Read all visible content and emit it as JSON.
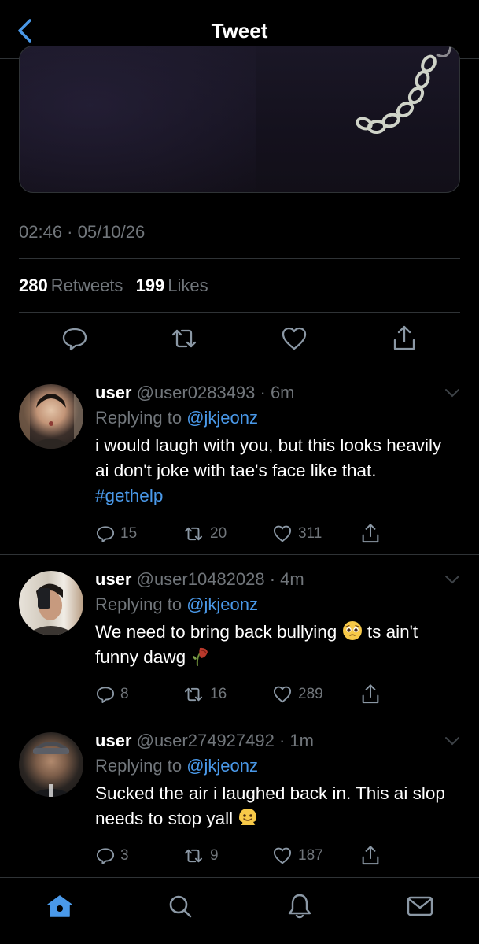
{
  "header": {
    "title": "Tweet"
  },
  "tweet": {
    "timestamp": "02:46 · 05/10/26",
    "retweets": "280",
    "retweets_label": "Retweets",
    "likes": "199",
    "likes_label": "Likes"
  },
  "replies": [
    {
      "name": "user",
      "meta": "@user0283493 · 6m",
      "replying_prefix": "Replying to",
      "replying_handle": "@jkjeonz",
      "text": "i would laugh with you, but this looks heavily ai don't joke with tae's face like that.",
      "hashtag": "#gethelp",
      "replies": "15",
      "retweets": "20",
      "likes": "311"
    },
    {
      "name": "user",
      "meta": "@user10482028 · 4m",
      "replying_prefix": "Replying to",
      "replying_handle": "@jkjeonz",
      "text_a": "We need to bring back bullying",
      "text_b": "ts ain't funny dawg",
      "replies": "8",
      "retweets": "16",
      "likes": "289"
    },
    {
      "name": "user",
      "meta": "@user274927492 · 1m",
      "replying_prefix": "Replying to",
      "replying_handle": "@jkjeonz",
      "text": "Sucked the air i laughed back in. This ai slop needs to stop yall",
      "replies": "3",
      "retweets": "9",
      "likes": "187"
    }
  ],
  "icons": {
    "back": "chevron-left-icon",
    "reply": "speech-bubble-icon",
    "retweet": "retweet-icon",
    "like": "heart-icon",
    "share": "share-icon",
    "more": "chevron-down-icon",
    "home": "home-icon",
    "search": "search-icon",
    "notifications": "bell-icon",
    "messages": "envelope-icon"
  },
  "colors": {
    "accent": "#4a99e9",
    "muted": "#71767b",
    "background": "#000000",
    "divider": "#2f3336"
  }
}
